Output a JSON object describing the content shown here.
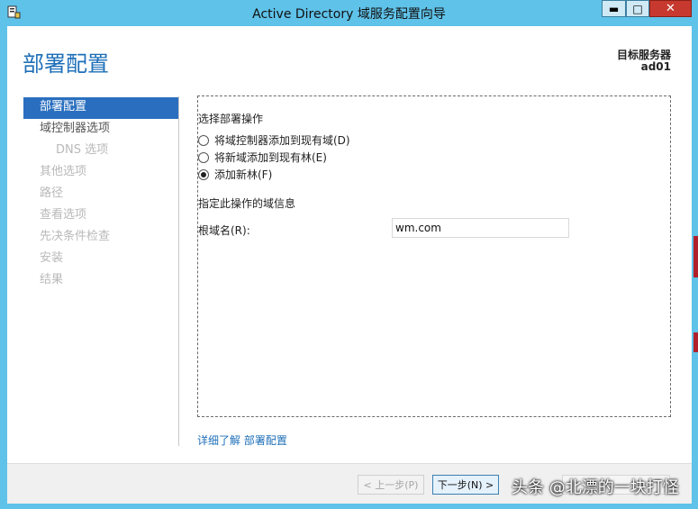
{
  "window": {
    "title": "Active Directory 域服务配置向导",
    "min_glyph": "▬",
    "max_glyph": "□",
    "close_glyph": "✕"
  },
  "header": {
    "page_title": "部署配置",
    "target_label": "目标服务器",
    "target_name": "ad01"
  },
  "nav": {
    "items": [
      {
        "label": "部署配置"
      },
      {
        "label": "域控制器选项"
      },
      {
        "label": "DNS 选项"
      },
      {
        "label": "其他选项"
      },
      {
        "label": "路径"
      },
      {
        "label": "查看选项"
      },
      {
        "label": "先决条件检查"
      },
      {
        "label": "安装"
      },
      {
        "label": "结果"
      }
    ]
  },
  "main": {
    "select_label": "选择部署操作",
    "options": [
      {
        "label": "将域控制器添加到现有域(D)",
        "selected": false
      },
      {
        "label": "将新域添加到现有林(E)",
        "selected": false
      },
      {
        "label": "添加新林(F)",
        "selected": true
      }
    ],
    "domain_info_label": "指定此操作的域信息",
    "root_domain_label": "根域名(R):",
    "root_domain_value": "wm.com",
    "more_link": "详细了解 部署配置"
  },
  "footer": {
    "prev_label": "< 上一步(P)",
    "next_label": "下一步(N) >"
  },
  "watermark": "头条 @北漂的一块打怪",
  "colors": {
    "titlebar": "#5fc2e9",
    "accent": "#1e6fb8",
    "nav_active": "#2a6fbf",
    "close": "#c7392e"
  },
  "icons": {
    "app": "server-wizard-icon"
  }
}
